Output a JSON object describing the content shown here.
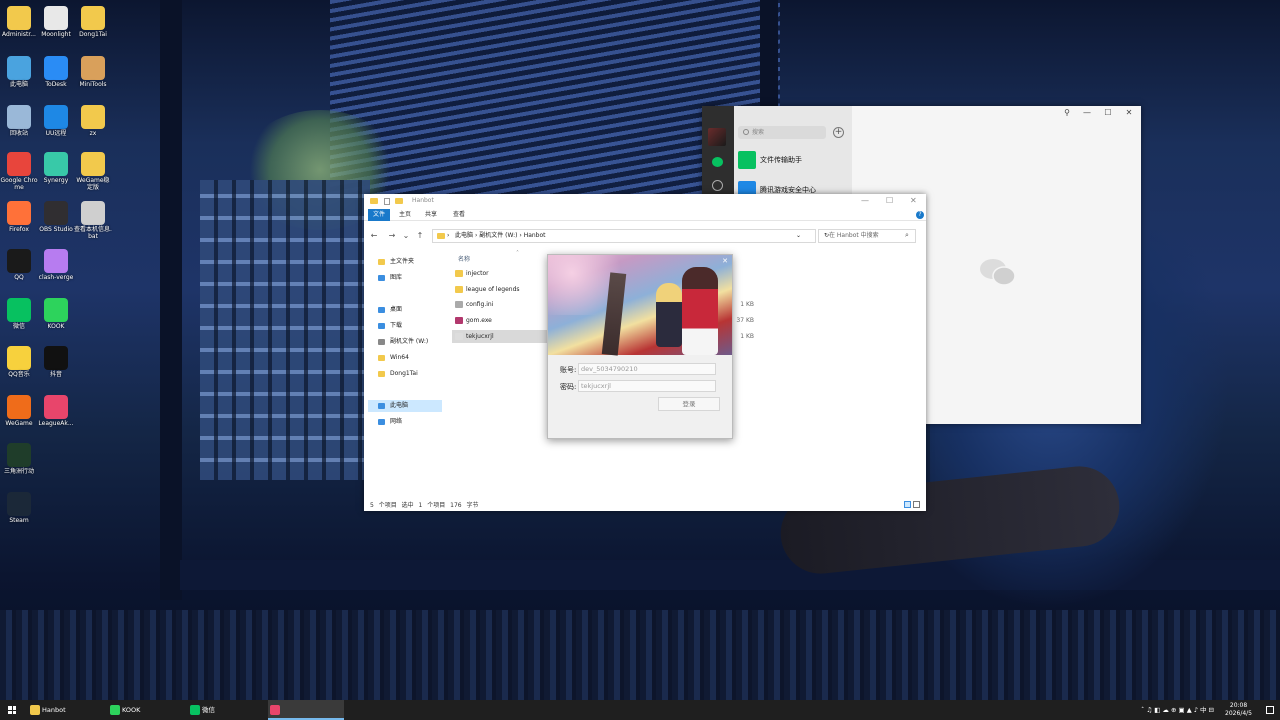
{
  "desktop": {
    "icons": [
      {
        "label": "Administr...",
        "icon": "folder-icon",
        "color": "#f2c94c"
      },
      {
        "label": "Moonlight",
        "icon": "moonlight-icon",
        "color": "#e8e8e8"
      },
      {
        "label": "Dong1Tai",
        "icon": "folder-icon",
        "color": "#f2c94c"
      },
      {
        "label": "此电脑",
        "icon": "computer-icon",
        "color": "#4aa3df"
      },
      {
        "label": "ToDesk",
        "icon": "todesk-icon",
        "color": "#2a8cf5"
      },
      {
        "label": "MiniTools",
        "icon": "minitools-icon",
        "color": "#d9a05b"
      },
      {
        "label": "回收站",
        "icon": "recycle-bin-icon",
        "color": "#9ab8d8"
      },
      {
        "label": "UU远程",
        "icon": "uu-remote-icon",
        "color": "#1e88e5"
      },
      {
        "label": "zx",
        "icon": "folder-icon",
        "color": "#f2c94c"
      },
      {
        "label": "Google Chrome",
        "icon": "chrome-icon",
        "color": "#e8453c"
      },
      {
        "label": "Synergy",
        "icon": "synergy-icon",
        "color": "#38c9a8"
      },
      {
        "label": "WeGame稳定版",
        "icon": "folder-icon",
        "color": "#f2c94c"
      },
      {
        "label": "Firefox",
        "icon": "firefox-icon",
        "color": "#ff7139"
      },
      {
        "label": "OBS Studio",
        "icon": "obs-icon",
        "color": "#302e31"
      },
      {
        "label": "查看本机信息.bat",
        "icon": "gear-icon",
        "color": "#cfcfcf"
      },
      {
        "label": "QQ",
        "icon": "qq-icon",
        "color": "#1a1a1a"
      },
      {
        "label": "clash-verge",
        "icon": "clash-icon",
        "color": "#b77cf0"
      },
      {
        "label": "微信",
        "icon": "wechat-icon",
        "color": "#07c160"
      },
      {
        "label": "KOOK",
        "icon": "kook-icon",
        "color": "#2dd35c"
      },
      {
        "label": "QQ音乐",
        "icon": "qqmusic-icon",
        "color": "#f7d13d"
      },
      {
        "label": "抖音",
        "icon": "douyin-icon",
        "color": "#111111"
      },
      {
        "label": "WeGame",
        "icon": "wegame-icon",
        "color": "#ef6c1a"
      },
      {
        "label": "LeagueAk...",
        "icon": "leagueakari-icon",
        "color": "#e8456b"
      },
      {
        "label": "三角洲行动",
        "icon": "delta-force-icon",
        "color": "#1f3d2a"
      },
      {
        "label": "Steam",
        "icon": "steam-icon",
        "color": "#1b2838"
      }
    ]
  },
  "wechat": {
    "search_placeholder": "搜索",
    "add_symbol": "+",
    "chats": [
      {
        "name": "文件传输助手",
        "color": "#07c160"
      },
      {
        "name": "腾讯游戏安全中心",
        "color": "#1e88e5"
      }
    ],
    "controls": {
      "pin": "⚲",
      "min": "—",
      "max": "☐",
      "close": "✕"
    }
  },
  "explorer": {
    "title": "Hanbot",
    "ribbon_tabs": [
      "文件",
      "主页",
      "共享",
      "查看"
    ],
    "path": [
      "此电脑",
      "副机文件 (W:)",
      "Hanbot"
    ],
    "search_placeholder": "在 Hanbot 中搜索",
    "controls": {
      "min": "—",
      "max": "☐",
      "close": "✕"
    },
    "sidebar": [
      {
        "label": "主文件夹",
        "color": "#f2c94c"
      },
      {
        "label": "图库",
        "color": "#3b8ee0"
      },
      {
        "label": "桌面",
        "color": "#3b8ee0"
      },
      {
        "label": "下载",
        "color": "#3b8ee0"
      },
      {
        "label": "副机文件 (W:)",
        "color": "#888888"
      },
      {
        "label": "Win64",
        "color": "#f2c94c"
      },
      {
        "label": "Dong1Tai",
        "color": "#f2c94c"
      },
      {
        "label": "此电脑",
        "color": "#3b8ee0"
      },
      {
        "label": "网络",
        "color": "#3b8ee0"
      }
    ],
    "column_header": "名称",
    "files": [
      {
        "name": "injector",
        "size": "",
        "color": "#f2c94c"
      },
      {
        "name": "league of legends",
        "size": "",
        "color": "#f2c94c"
      },
      {
        "name": "config.ini",
        "size": "1 KB",
        "color": "#aaaaaa"
      },
      {
        "name": "gom.exe",
        "size": "37 KB",
        "color": "#b2386d"
      },
      {
        "name": "tekjucxrjl",
        "size": "1 KB",
        "color": "#dddddd"
      }
    ],
    "status": "5 个项目    选中 1 个项目  176 字节"
  },
  "login": {
    "account_label": "账号:",
    "account_value": "dev_5034790210",
    "password_label": "密码:",
    "password_value": "tekjucxrjl",
    "login_button": "登录"
  },
  "taskbar": {
    "items": [
      {
        "label": "Hanbot",
        "color": "#f2c94c"
      },
      {
        "label": "KOOK",
        "color": "#2dd35c"
      },
      {
        "label": "微信",
        "color": "#07c160"
      },
      {
        "label": "",
        "color": "#e8456b"
      }
    ],
    "tray": "ˆ  ♫  ◧  ☁  ⊕  ▣  ▲  ♪  中  ⊟",
    "time": "20:08",
    "date": "2026/4/5"
  }
}
